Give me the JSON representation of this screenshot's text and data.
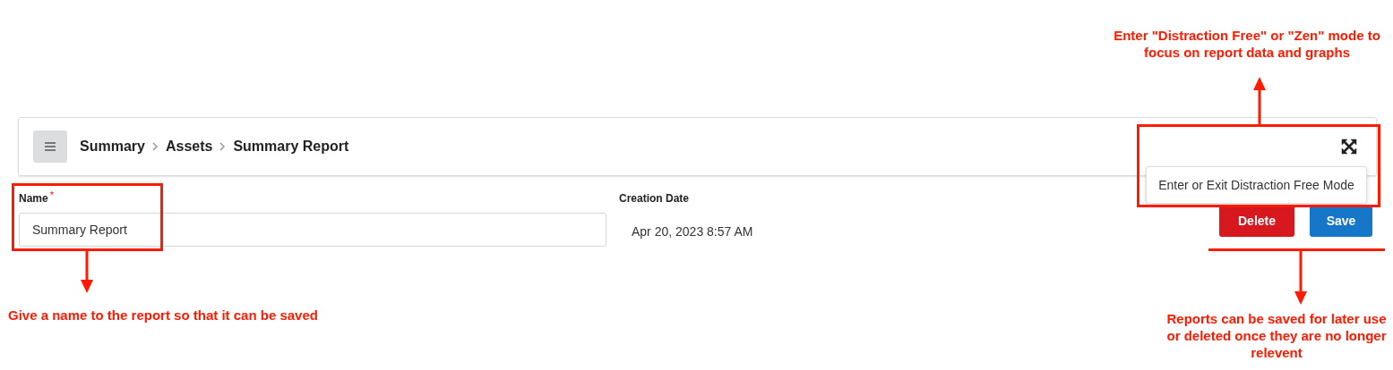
{
  "header": {
    "breadcrumb": [
      {
        "label": "Summary"
      },
      {
        "label": "Assets"
      },
      {
        "label": "Summary Report"
      }
    ],
    "tooltip": "Enter or Exit Distraction Free Mode"
  },
  "form": {
    "name": {
      "label": "Name",
      "required_mark": "*",
      "value": "Summary Report"
    },
    "creation_date": {
      "label": "Creation Date",
      "value": "Apr 20, 2023 8:57 AM"
    }
  },
  "buttons": [
    {
      "label": "Delete",
      "kind": "danger"
    },
    {
      "label": "Save",
      "kind": "primary"
    }
  ],
  "annotations": [
    {
      "kind": "up",
      "text": "Enter \"Distraction Free\" or \"Zen\" mode to focus on report data and graphs"
    },
    {
      "kind": "name",
      "text": "Give a name to the report so that it can be saved"
    },
    {
      "kind": "buttons",
      "text": "Reports can be saved for later use or deleted once they are no longer relevent"
    }
  ]
}
